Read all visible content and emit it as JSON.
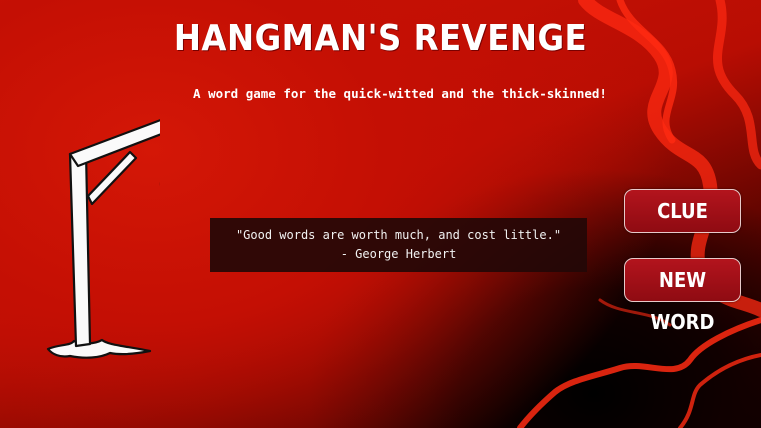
{
  "game": {
    "title": "HANGMAN'S REVENGE",
    "subtitle": "A word game for the quick-witted and the thick-skinned!",
    "quote": {
      "text": "\"Good words are worth much, and cost little.\"",
      "author": "- George Herbert"
    },
    "buttons": {
      "clue": "CLUE",
      "new_word": "NEW WORD"
    }
  },
  "colors": {
    "background_red": "#c80f05",
    "button_red": "#a3101a",
    "smoke_red": "#ff2a10",
    "quote_box": "#230806"
  },
  "icons": [
    "gallows-icon",
    "noose-icon"
  ]
}
